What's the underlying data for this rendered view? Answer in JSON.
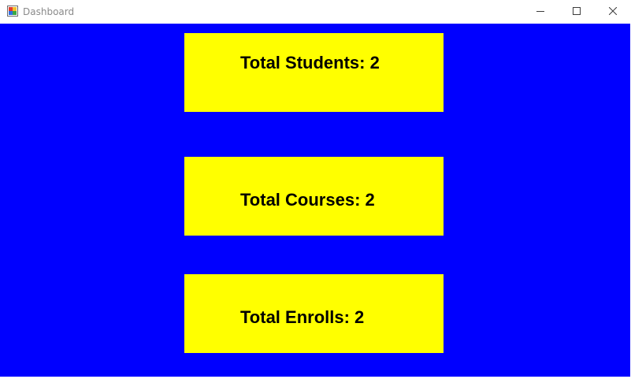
{
  "window": {
    "title": "Dashboard",
    "icon": "winforms-app-icon",
    "controls": {
      "minimize_icon": "minimize-icon",
      "maximize_icon": "maximize-icon",
      "close_icon": "close-icon"
    }
  },
  "colors": {
    "background": "#0000FF",
    "card": "#FFFF00",
    "text": "#000000"
  },
  "stats": [
    {
      "label": "Total Students: 2"
    },
    {
      "label": "Total Courses: 2"
    },
    {
      "label": "Total Enrolls: 2"
    }
  ]
}
